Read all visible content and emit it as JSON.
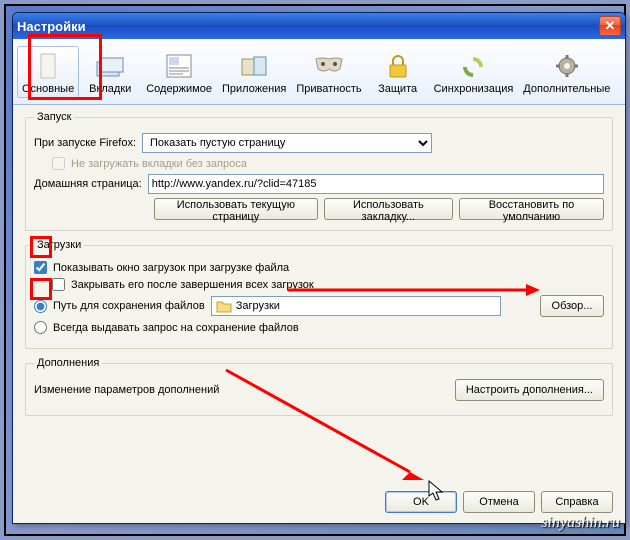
{
  "window": {
    "title": "Настройки"
  },
  "toolbar": {
    "items": [
      {
        "label": "Основные",
        "active": true
      },
      {
        "label": "Вкладки"
      },
      {
        "label": "Содержимое"
      },
      {
        "label": "Приложения"
      },
      {
        "label": "Приватность"
      },
      {
        "label": "Защита"
      },
      {
        "label": "Синхронизация"
      },
      {
        "label": "Дополнительные"
      }
    ]
  },
  "startup": {
    "legend": "Запуск",
    "on_start_label": "При запуске Firefox:",
    "on_start_value": "Показать пустую страницу",
    "dont_load_tabs": "Не загружать вкладки без запроса",
    "homepage_label": "Домашняя страница:",
    "homepage_value": "http://www.yandex.ru/?clid=47185",
    "use_current": "Использовать текущую страницу",
    "use_bookmark": "Использовать закладку...",
    "restore_default": "Восстановить по умолчанию"
  },
  "downloads": {
    "legend": "Загрузки",
    "show_window": "Показывать окно загрузок при загрузке файла",
    "close_after": "Закрывать его после завершения всех загрузок",
    "save_to": "Путь для сохранения файлов",
    "folder": "Загрузки",
    "browse": "Обзор...",
    "always_ask": "Всегда выдавать запрос на сохранение файлов"
  },
  "addons": {
    "legend": "Дополнения",
    "change_params": "Изменение параметров дополнений",
    "manage": "Настроить дополнения..."
  },
  "dialog": {
    "ok": "OK",
    "cancel": "Отмена",
    "help": "Справка"
  },
  "watermark": "sinyashin.ru"
}
